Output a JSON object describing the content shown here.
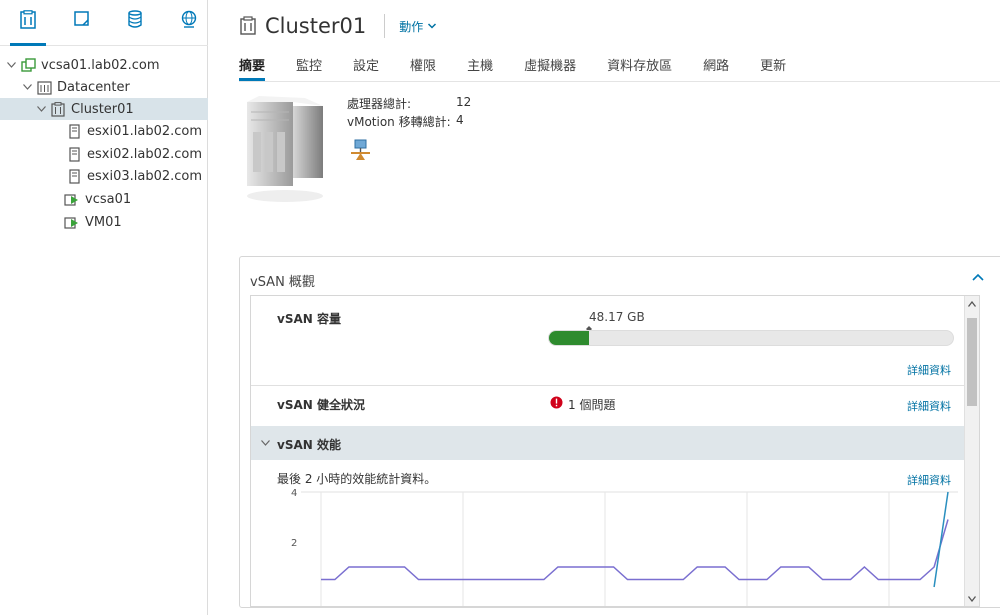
{
  "nav": {
    "tree": [
      {
        "label": "vcsa01.lab02.com",
        "icon": "vcenter-icon",
        "expanded": true
      },
      {
        "label": "Datacenter",
        "icon": "datacenter-icon",
        "expanded": true
      },
      {
        "label": "Cluster01",
        "icon": "cluster-icon",
        "expanded": true,
        "selected": true
      },
      {
        "label": "esxi01.lab02.com",
        "icon": "host-icon"
      },
      {
        "label": "esxi02.lab02.com",
        "icon": "host-icon"
      },
      {
        "label": "esxi03.lab02.com",
        "icon": "host-icon"
      },
      {
        "label": "vcsa01",
        "icon": "vm-icon"
      },
      {
        "label": "VM01",
        "icon": "vm-icon"
      }
    ]
  },
  "header": {
    "title": "Cluster01",
    "actions_label": "動作"
  },
  "tabs": [
    "摘要",
    "監控",
    "設定",
    "權限",
    "主機",
    "虛擬機器",
    "資料存放區",
    "網路",
    "更新"
  ],
  "summary": {
    "cpu_label": "處理器總計:",
    "cpu_value": "12",
    "vmotion_label": "vMotion 移轉總計:",
    "vmotion_value": "4"
  },
  "vsan": {
    "card_title": "vSAN 概觀",
    "capacity_label": "vSAN 容量",
    "capacity_value": "48.17 GB",
    "capacity_used_fraction": 0.1,
    "details_label": "詳細資料",
    "health_label": "vSAN 健全狀況",
    "health_status": "1 個問題",
    "perf_label": "vSAN 效能",
    "perf_desc": "最後 2 小時的效能統計資料。"
  },
  "colors": {
    "accent": "#0079b8",
    "link": "#0072a3",
    "green": "#2e8b2e",
    "error": "#d0021b",
    "series1": "#7a6fd0",
    "series2": "#2a8fbf"
  },
  "chart_data": {
    "type": "line",
    "y_ticks": [
      "4",
      "2"
    ],
    "ylim": [
      0,
      4
    ],
    "x": [
      0,
      1,
      2,
      3,
      4,
      5,
      6,
      7,
      8,
      9,
      10,
      11,
      12,
      13,
      14,
      15,
      16,
      17,
      18,
      19,
      20,
      21,
      22,
      23,
      24,
      25,
      26,
      27,
      28,
      29,
      30,
      31,
      32,
      33,
      34,
      35,
      36,
      37,
      38,
      39,
      40,
      41,
      42,
      43,
      44,
      45
    ],
    "series": [
      {
        "values": [
          0.5,
          0.5,
          1.0,
          1.0,
          1.0,
          1.0,
          1.0,
          0.5,
          0.5,
          0.5,
          0.5,
          0.5,
          0.5,
          0.5,
          0.5,
          0.5,
          0.5,
          1.0,
          1.0,
          1.0,
          1.0,
          1.0,
          0.5,
          0.5,
          0.5,
          0.5,
          0.5,
          1.0,
          1.0,
          1.0,
          0.5,
          0.5,
          0.5,
          1.0,
          1.0,
          1.0,
          0.5,
          0.5,
          0.5,
          1.0,
          0.5,
          0.5,
          0.5,
          0.5,
          1.0,
          2.9
        ]
      },
      {
        "values": [
          0,
          0,
          0,
          0,
          0,
          0,
          0,
          0,
          0,
          0,
          0,
          0,
          0,
          0,
          0,
          0,
          0,
          0,
          0,
          0,
          0,
          0,
          0,
          0,
          0,
          0,
          0,
          0,
          0,
          0,
          0,
          0,
          0,
          0,
          0,
          0,
          0,
          0,
          0,
          0,
          0,
          0,
          0,
          0,
          0.2,
          4.0
        ]
      }
    ]
  }
}
